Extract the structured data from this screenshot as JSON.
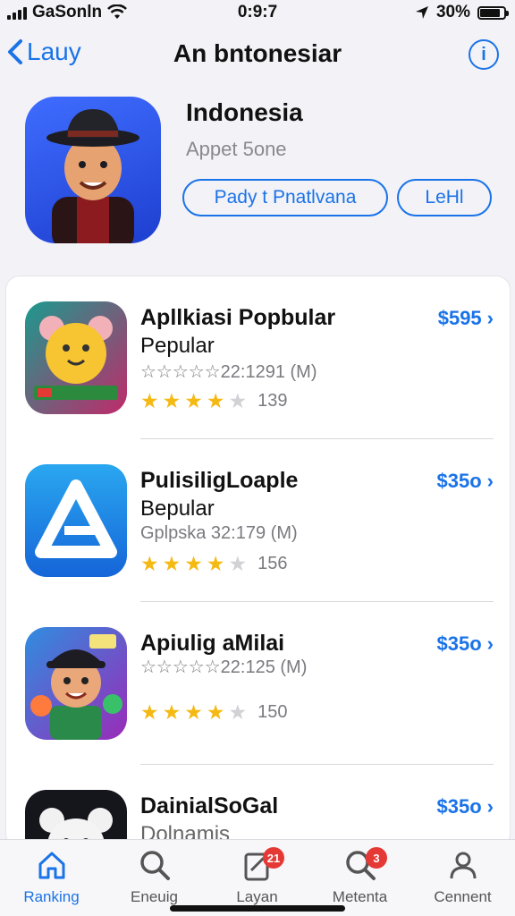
{
  "status": {
    "carrier": "GaSonln",
    "time": "0:9:7",
    "battery": "30%"
  },
  "nav": {
    "back_label": "Lauy",
    "title": "An bntonesiar",
    "info_label": "i"
  },
  "hero": {
    "name": "Indonesia",
    "subtitle": "Appet 5one",
    "button_primary": "Pady t Pnatlvana",
    "button_secondary": "LeHl"
  },
  "apps": [
    {
      "title": "Apllkiasi Popbular",
      "subtitle": "Pepular",
      "meta": "☆☆☆☆☆22:1291 (M)",
      "rating": 4,
      "rating_count": "139",
      "price": "$595",
      "icon": "hamster-icon"
    },
    {
      "title": "PulisiligLoaple",
      "subtitle": "Bepular",
      "meta": "Gplpska 32:179 (M)",
      "rating": 4,
      "rating_count": "156",
      "price": "$35o",
      "icon": "triangle-logo-icon"
    },
    {
      "title": "Apiulig aMilai",
      "subtitle": "",
      "meta": "☆☆☆☆☆22:125 (M)",
      "rating": 4,
      "rating_count": "150",
      "price": "$35o",
      "icon": "cartoon-boy-icon"
    },
    {
      "title": "DainialSoGal",
      "subtitle": "Dolnamis",
      "meta": "",
      "rating": 0,
      "rating_count": "",
      "price": "$35o",
      "icon": "bear-icon"
    }
  ],
  "tabs": [
    {
      "label": "Ranking",
      "icon": "home-icon",
      "active": true,
      "badge": ""
    },
    {
      "label": "Eneuig",
      "icon": "search-icon",
      "active": false,
      "badge": ""
    },
    {
      "label": "Layan",
      "icon": "edit-document-icon",
      "active": false,
      "badge": "21"
    },
    {
      "label": "Metenta",
      "icon": "search-icon",
      "active": false,
      "badge": "3"
    },
    {
      "label": "Cennent",
      "icon": "person-icon",
      "active": false,
      "badge": ""
    }
  ],
  "colors": {
    "accent": "#1a73e8",
    "star": "#f5b914",
    "badge": "#e53935"
  }
}
